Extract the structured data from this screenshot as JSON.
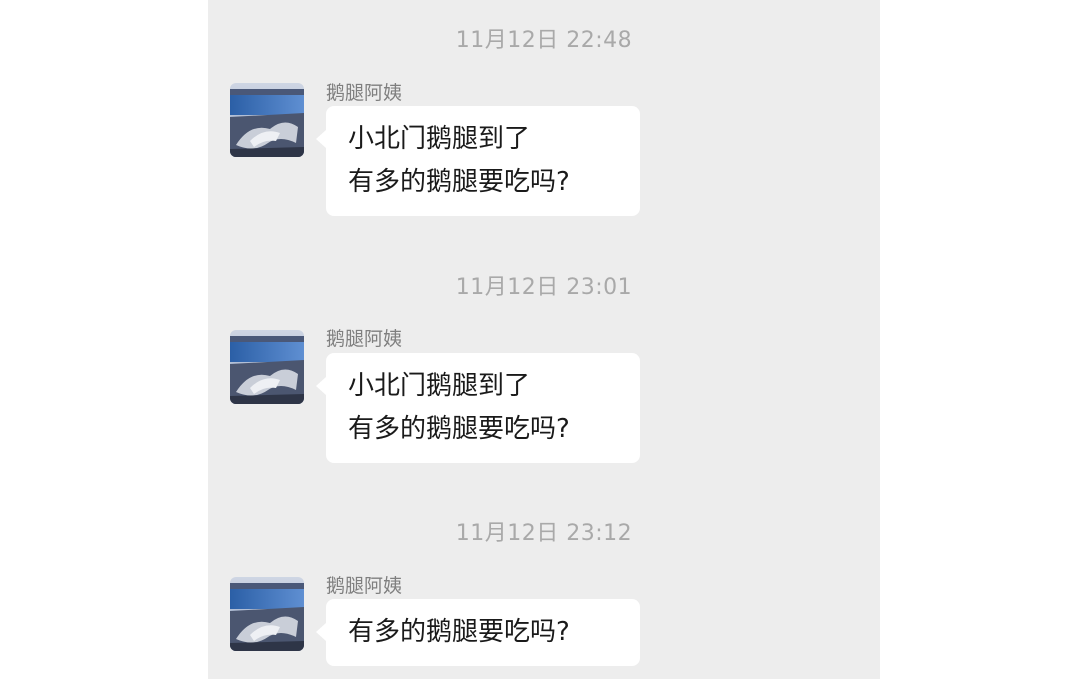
{
  "chat": {
    "messages": [
      {
        "timestamp": "11月12日 22:48",
        "sender": "鹅腿阿姨",
        "lines": [
          "小北门鹅腿到了",
          "有多的鹅腿要吃吗?"
        ]
      },
      {
        "timestamp": "11月12日 23:01",
        "sender": "鹅腿阿姨",
        "lines": [
          "小北门鹅腿到了",
          "有多的鹅腿要吃吗?"
        ]
      },
      {
        "timestamp": "11月12日 23:12",
        "sender": "鹅腿阿姨",
        "lines": [
          "有多的鹅腿要吃吗?"
        ]
      }
    ]
  },
  "colors": {
    "panel_background": "#ededed",
    "bubble_background": "#ffffff",
    "timestamp_text": "#a9a9a9",
    "sender_text": "#7f7f7f"
  },
  "icons": {
    "avatar": "landscape-photo-avatar"
  }
}
